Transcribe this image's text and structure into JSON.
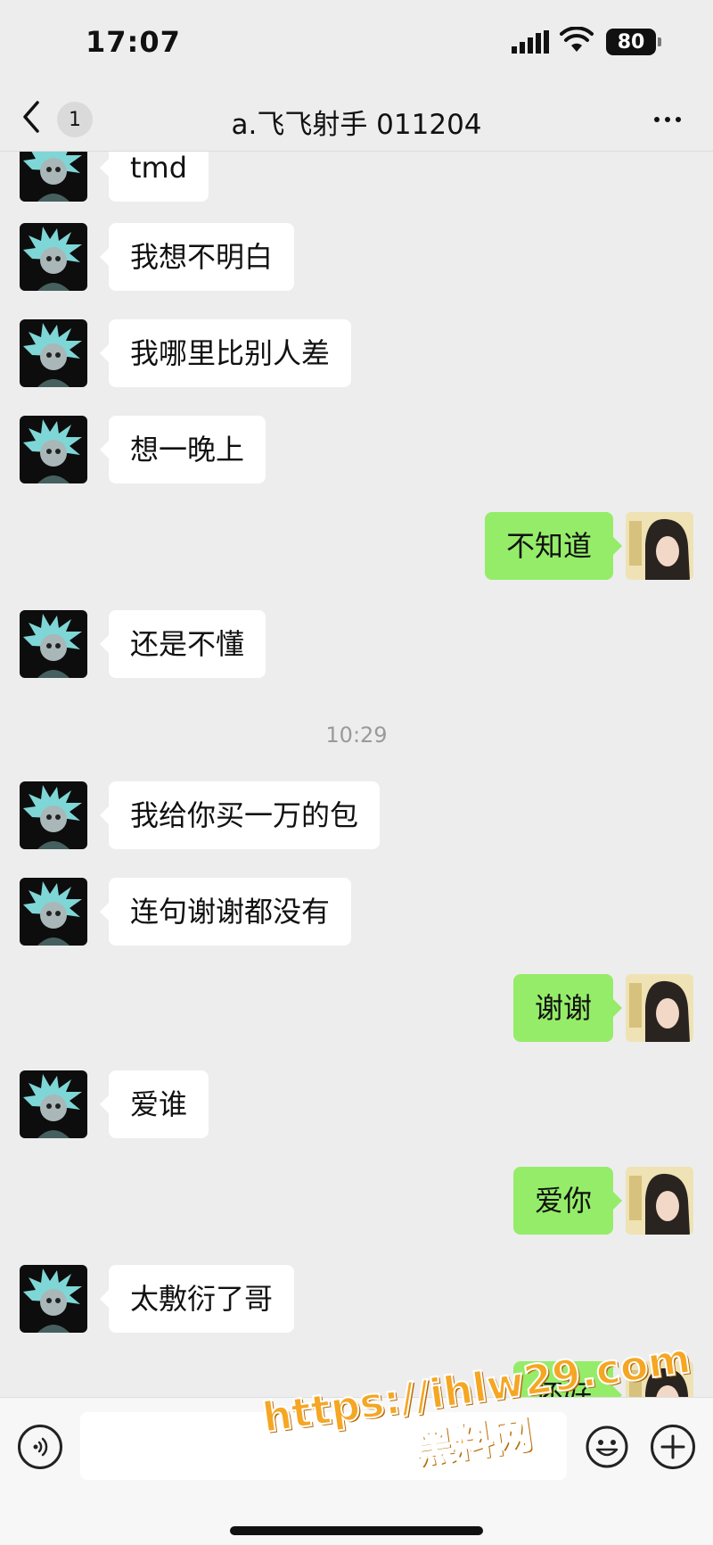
{
  "status": {
    "time": "17:07",
    "battery": "80"
  },
  "nav": {
    "unread_count": "1",
    "title": "a.飞飞射手 011204"
  },
  "messages": [
    {
      "side": "left",
      "text": "tmd"
    },
    {
      "side": "left",
      "text": "我想不明白"
    },
    {
      "side": "left",
      "text": "我哪里比别人差"
    },
    {
      "side": "left",
      "text": "想一晚上"
    },
    {
      "side": "right",
      "text": "不知道"
    },
    {
      "side": "left",
      "text": "还是不懂"
    },
    {
      "side": "left",
      "text": "我给你买一万的包"
    },
    {
      "side": "left",
      "text": "连句谢谢都没有"
    },
    {
      "side": "right",
      "text": "谢谢"
    },
    {
      "side": "left",
      "text": "爱谁"
    },
    {
      "side": "right",
      "text": "爱你"
    },
    {
      "side": "left",
      "text": "太敷衍了哥"
    },
    {
      "side": "right",
      "text": "还好"
    }
  ],
  "time_divider": "10:29",
  "input": {
    "placeholder": ""
  },
  "watermark": {
    "url": "https://ihlw29.com",
    "name": "黑料网"
  },
  "colors": {
    "background": "#ededed",
    "bubble_self": "#95ec69",
    "bubble_other": "#ffffff"
  },
  "icons": [
    "signal-icon",
    "wifi-icon",
    "battery-icon",
    "back-chevron-icon",
    "more-icon",
    "voice-icon",
    "emoji-icon",
    "plus-icon"
  ]
}
